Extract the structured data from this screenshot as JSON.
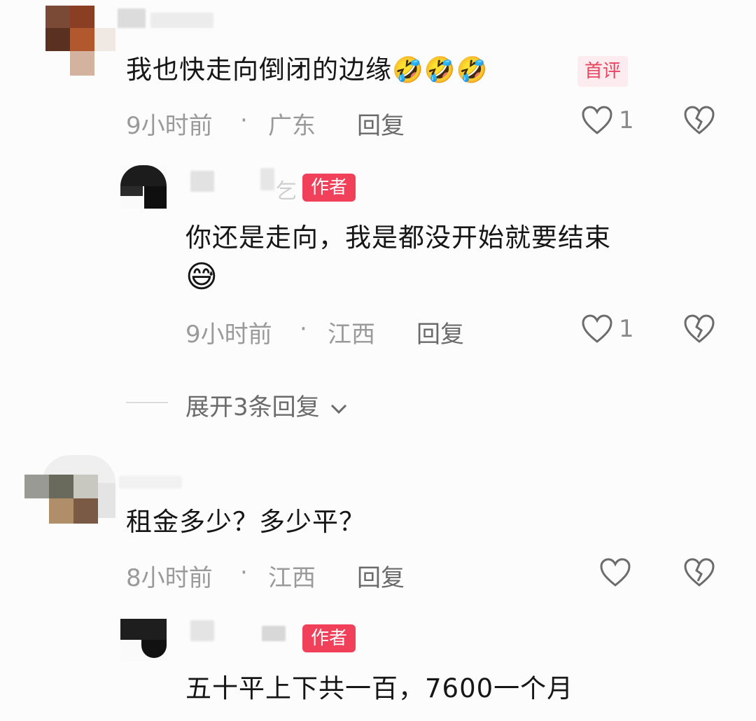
{
  "comments": [
    {
      "text": "我也快走向倒闭的边缘",
      "emoji": "🤣🤣🤣",
      "badge": "首评",
      "time": "9小时前",
      "sep": "·",
      "location": "广东",
      "reply": "回复",
      "likes": "1",
      "author_reply": {
        "name_fragment": "乞",
        "badge": "作者",
        "text_line1": "你还是走向，我是都没开始就要结束",
        "emoji": "😅",
        "time": "9小时前",
        "sep": "·",
        "location": "江西",
        "reply": "回复",
        "likes": "1"
      },
      "expand": "展开3条回复"
    },
    {
      "text": "租金多少？多少平？",
      "time": "8小时前",
      "sep": "·",
      "location": "江西",
      "reply": "回复",
      "likes": "",
      "author_reply": {
        "badge": "作者",
        "text_line1": "五十平上下共一百，7600一个月"
      }
    }
  ],
  "icons": {
    "like": "heart-outline-icon",
    "dislike": "broken-heart-icon",
    "expand": "chevron-down-icon"
  }
}
